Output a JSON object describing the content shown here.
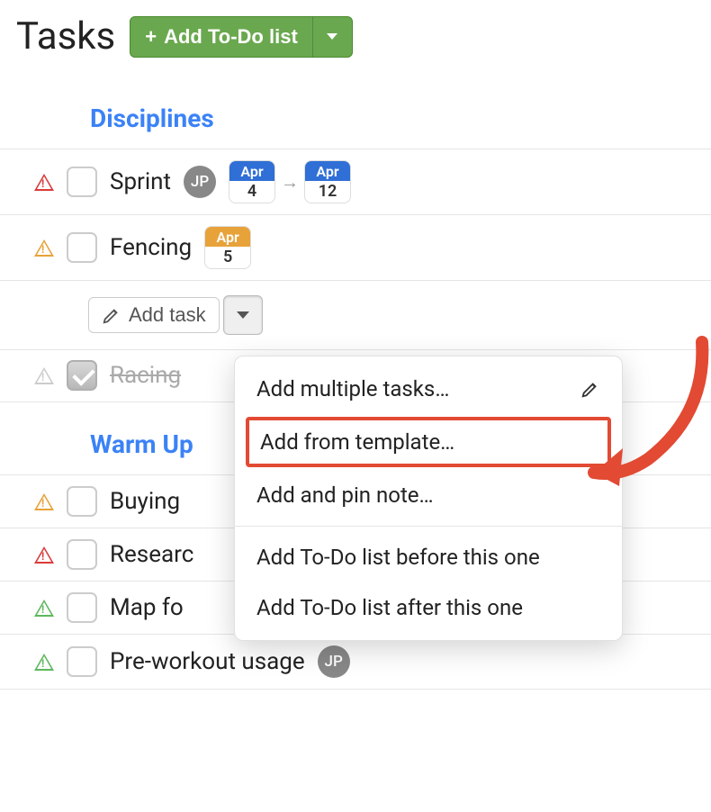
{
  "header": {
    "title": "Tasks",
    "add_button_label": "Add To-Do list"
  },
  "sections": [
    {
      "title": "Disciplines",
      "tasks": [
        {
          "warn_color": "red",
          "checked": false,
          "name": "Sprint",
          "avatar": "JP",
          "date_start": {
            "month": "Apr",
            "day": "4",
            "color": "blue"
          },
          "date_end": {
            "month": "Apr",
            "day": "12",
            "color": "blue"
          }
        },
        {
          "warn_color": "orange",
          "checked": false,
          "name": "Fencing",
          "date_start": {
            "month": "Apr",
            "day": "5",
            "color": "orange"
          }
        }
      ],
      "add_task_label": "Add task",
      "completed": [
        {
          "warn_color": "gray",
          "checked": true,
          "name": "Racing"
        }
      ]
    },
    {
      "title": "Warm Up",
      "tasks": [
        {
          "warn_color": "orange",
          "checked": false,
          "name": "Buying"
        },
        {
          "warn_color": "red",
          "checked": false,
          "name": "Researc"
        },
        {
          "warn_color": "green",
          "checked": false,
          "name": "Map fo"
        },
        {
          "warn_color": "green",
          "checked": false,
          "name": "Pre-workout usage",
          "avatar": "JP"
        }
      ]
    }
  ],
  "dropdown": {
    "items": [
      "Add multiple tasks…",
      "Add from template…",
      "Add and pin note…",
      "Add To-Do list before this one",
      "Add To-Do list after this one"
    ]
  },
  "colors": {
    "accent_green": "#6aa84f",
    "link_blue": "#3b82f6",
    "highlight_red": "#e24a33"
  }
}
